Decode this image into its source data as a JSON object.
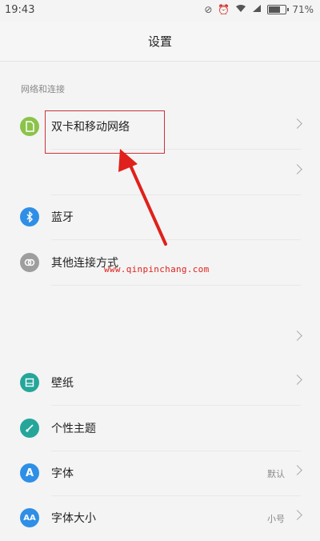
{
  "status_bar": {
    "time": "19:43",
    "battery": "71%"
  },
  "header": {
    "title": "设置"
  },
  "sections": {
    "network_header": "网络和连接"
  },
  "rows": {
    "dual_sim": {
      "label": "双卡和移动网络",
      "icon": "sim-card-icon",
      "color": "#8bc34a"
    },
    "bluetooth": {
      "label": "蓝牙",
      "icon": "bluetooth-icon",
      "color": "#2f8fe6"
    },
    "other_connect": {
      "label": "其他连接方式",
      "icon": "link-icon",
      "color": "#9e9e9e"
    },
    "wallpaper": {
      "label": "壁纸",
      "icon": "wallpaper-icon",
      "color": "#26a69a"
    },
    "theme": {
      "label": "个性主题",
      "icon": "theme-brush-icon",
      "color": "#26a69a"
    },
    "font": {
      "label": "字体",
      "value": "默认",
      "icon": "font-a-icon",
      "color": "#2f8fe6"
    },
    "font_size": {
      "label": "字体大小",
      "value": "小号",
      "icon": "font-size-icon",
      "color": "#2f8fe6"
    }
  },
  "watermark": "www.qinpinchang.com",
  "annotation": {
    "highlight_color": "#c8323a",
    "arrow_color": "#e0201c"
  }
}
